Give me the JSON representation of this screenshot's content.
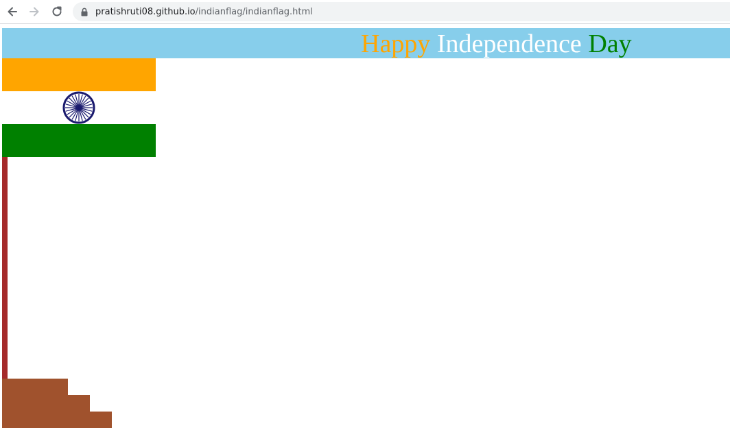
{
  "browser": {
    "url_host": "pratishruti08.github.io",
    "url_path": "/indianflag/indianflag.html",
    "icons": {
      "back": "arrow-left-icon",
      "forward": "arrow-right-icon",
      "reload": "reload-icon",
      "lock": "lock-icon"
    }
  },
  "banner": {
    "word1": "Happy",
    "word2": "Independence",
    "word3": "Day",
    "background": "#87ceeb",
    "color1": "#ffa500",
    "color2": "#ffffff",
    "color3": "#008000"
  },
  "flag": {
    "saffron": "#ffa500",
    "white": "#ffffff",
    "green": "#008000",
    "chakra_color": "#1a1a6e",
    "chakra_spokes": 24
  },
  "pole": {
    "color": "#a52a2a"
  },
  "steps": {
    "color": "#a0522d",
    "count": 3
  }
}
